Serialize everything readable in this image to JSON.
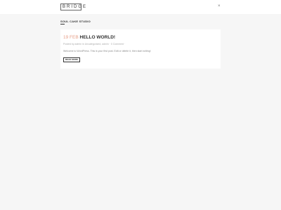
{
  "header": {
    "logo_text": "BRIDGE",
    "close_glyph": "×",
    "close_icon": "close-icon"
  },
  "page": {
    "blog_title": "SOUL CAKE STUDIO"
  },
  "post": {
    "date": "19 FEB",
    "title": "HELLO WORLD!",
    "meta": "Posted by admin in Uncategorized, admin · 0 Comment ·",
    "excerpt": "Welcome to WordPress. This is your first post. Edit or delete it, then start writing!",
    "read_more": "READ MORE"
  },
  "colors": {
    "accent": "#e7a08a",
    "background": "#f6f6f6",
    "card": "#ffffff"
  }
}
